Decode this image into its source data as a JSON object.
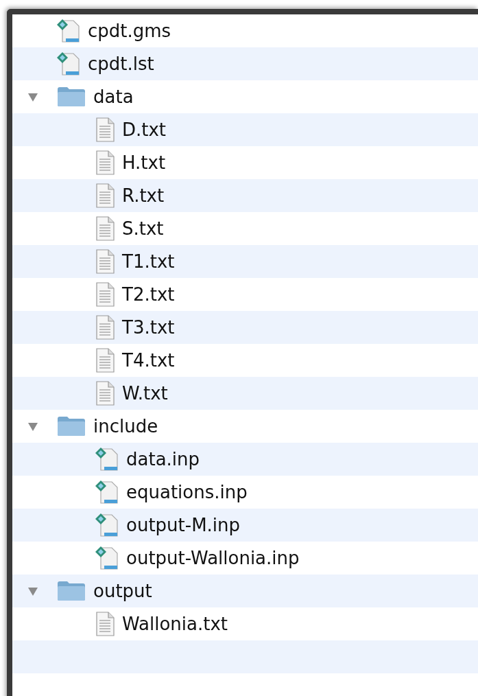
{
  "items": [
    {
      "kind": "gams",
      "name": "cpdt.gms"
    },
    {
      "kind": "gams",
      "name": "cpdt.lst"
    },
    {
      "kind": "folder",
      "name": "data",
      "expanded": true,
      "children": [
        {
          "kind": "text",
          "name": "D.txt"
        },
        {
          "kind": "text",
          "name": "H.txt"
        },
        {
          "kind": "text",
          "name": "R.txt"
        },
        {
          "kind": "text",
          "name": "S.txt"
        },
        {
          "kind": "text",
          "name": "T1.txt"
        },
        {
          "kind": "text",
          "name": "T2.txt"
        },
        {
          "kind": "text",
          "name": "T3.txt"
        },
        {
          "kind": "text",
          "name": "T4.txt"
        },
        {
          "kind": "text",
          "name": "W.txt"
        }
      ]
    },
    {
      "kind": "folder",
      "name": "include",
      "expanded": true,
      "children": [
        {
          "kind": "gams",
          "name": "data.inp"
        },
        {
          "kind": "gams",
          "name": "equations.inp"
        },
        {
          "kind": "gams",
          "name": "output-M.inp"
        },
        {
          "kind": "gams",
          "name": "output-Wallonia.inp"
        }
      ]
    },
    {
      "kind": "folder",
      "name": "output",
      "expanded": true,
      "children": [
        {
          "kind": "text",
          "name": "Wallonia.txt"
        }
      ]
    }
  ]
}
